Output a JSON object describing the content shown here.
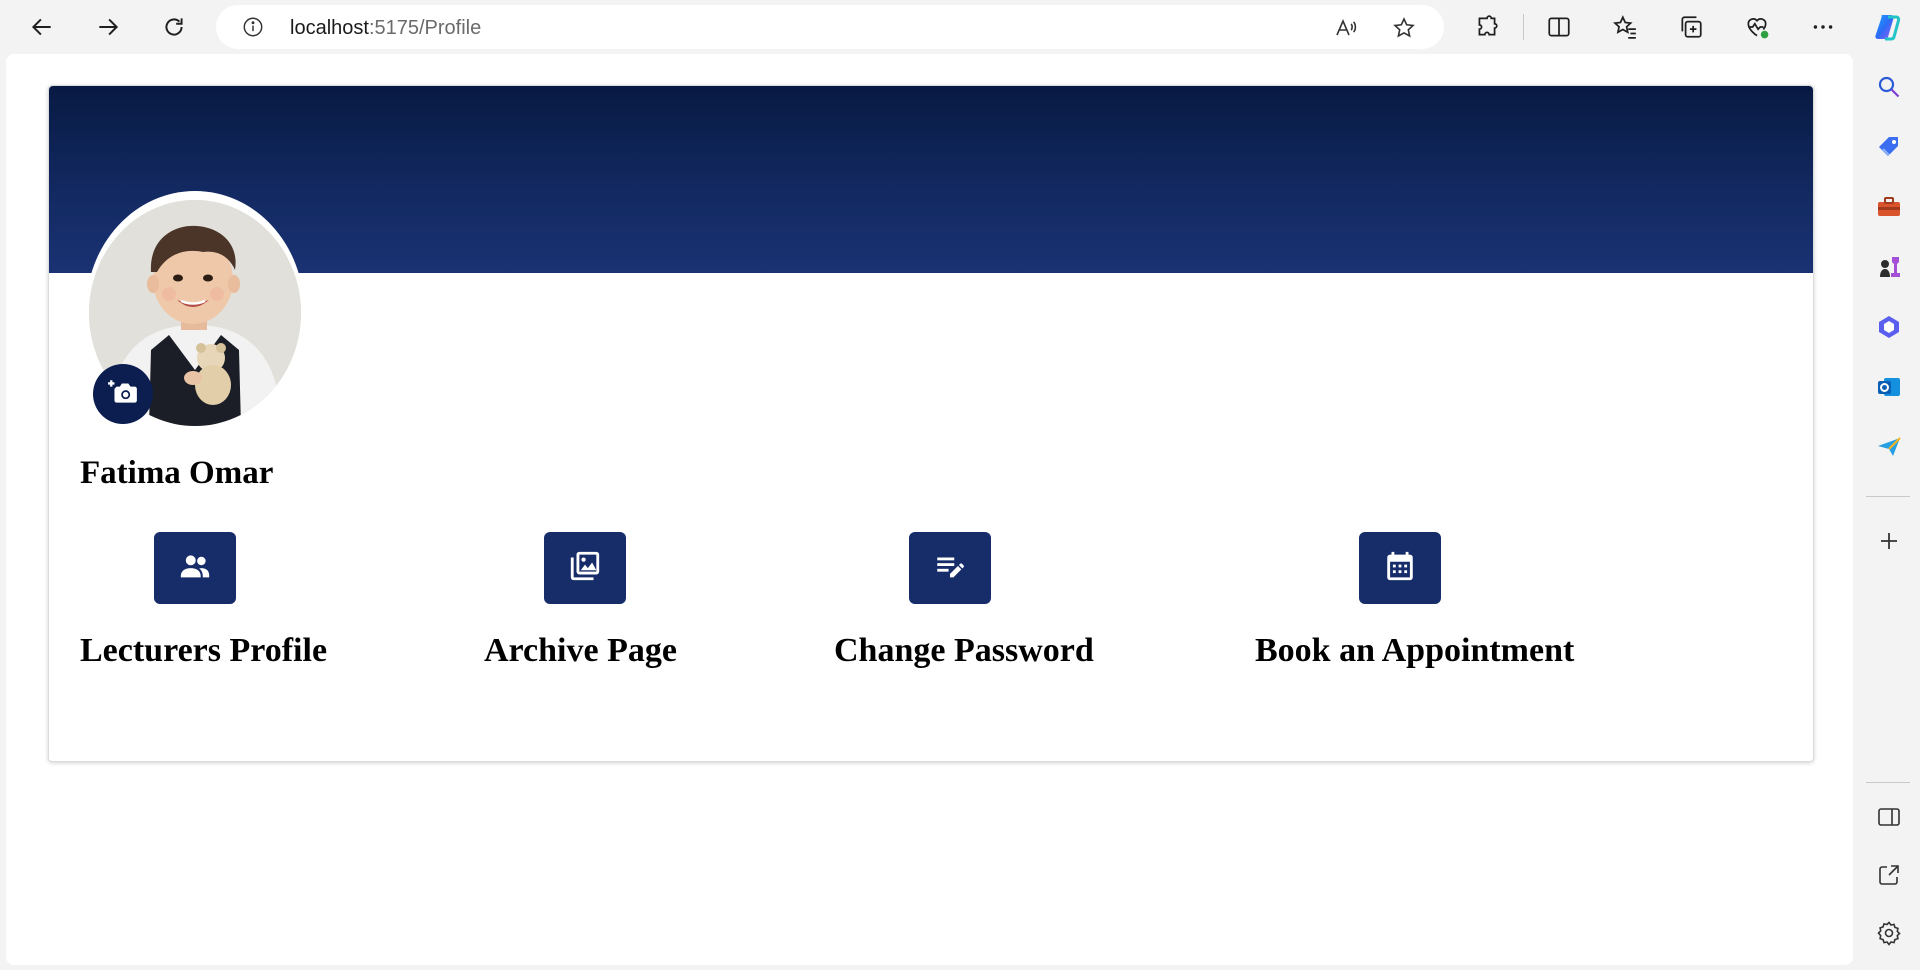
{
  "browser": {
    "url_host": "localhost",
    "url_path": ":5175/Profile"
  },
  "icons": {
    "back": "back-arrow-icon",
    "forward": "forward-arrow-icon",
    "refresh": "refresh-icon",
    "info": "info-icon",
    "read_aloud": "read-aloud-icon",
    "favorite": "star-icon",
    "extensions": "puzzle-icon",
    "split": "split-screen-icon",
    "favorites": "favorites-icon",
    "collections": "collections-icon",
    "health": "browser-essentials-icon",
    "more": "more-icon",
    "copilot": "copilot-icon"
  },
  "profile": {
    "name": "Fatima Omar"
  },
  "actions": [
    {
      "label": "Lecturers Profile",
      "icon": "people-icon"
    },
    {
      "label": "Archive Page",
      "icon": "photo-library-icon"
    },
    {
      "label": "Change Password",
      "icon": "edit-note-icon"
    },
    {
      "label": "Book an Appointment",
      "icon": "calendar-icon"
    }
  ],
  "colors": {
    "banner_top": "#081a43",
    "banner_bottom": "#1a3273",
    "button": "#172d6a",
    "camera_button": "#0c1e4f"
  }
}
